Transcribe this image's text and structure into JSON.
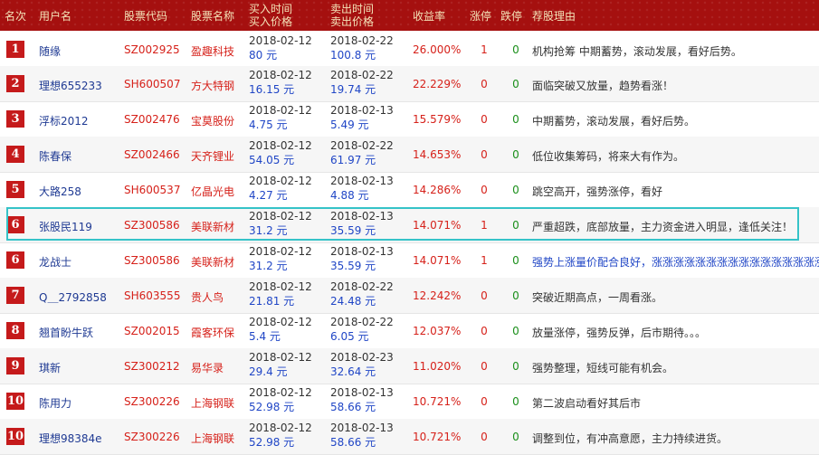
{
  "headers": {
    "rank": "名次",
    "user": "用户名",
    "code": "股票代码",
    "name": "股票名称",
    "buy_line1": "买入时间",
    "buy_line2": "买入价格",
    "sell_line1": "卖出时间",
    "sell_line2": "卖出价格",
    "rate": "收益率",
    "zt": "涨停",
    "dt": "跌停",
    "reason": "荐股理由"
  },
  "colors": {
    "header_bg": "#a5100f",
    "header_text": "#f4e3b8",
    "rank_bg": "#c51a1b",
    "stock_red": "#d6211a",
    "price_blue": "#2046c6",
    "highlight": "#35c3c8"
  },
  "rows": [
    {
      "rank": "1",
      "user": "随缘",
      "code": "SZ002925",
      "name": "盈趣科技",
      "buy_date": "2018-02-12",
      "buy_price": "80 元",
      "sell_date": "2018-02-22",
      "sell_price": "100.8 元",
      "rate": "26.000%",
      "zt": "1",
      "dt": "0",
      "reason": "机构抢筹 中期蓄势，滚动发展，看好后势。"
    },
    {
      "rank": "2",
      "user": "理想655233",
      "code": "SH600507",
      "name": "方大特钢",
      "buy_date": "2018-02-12",
      "buy_price": "16.15 元",
      "sell_date": "2018-02-22",
      "sell_price": "19.74 元",
      "rate": "22.229%",
      "zt": "0",
      "dt": "0",
      "reason": "面临突破又放量，趋势看涨！"
    },
    {
      "rank": "3",
      "user": "浮标2012",
      "code": "SZ002476",
      "name": "宝莫股份",
      "buy_date": "2018-02-12",
      "buy_price": "4.75 元",
      "sell_date": "2018-02-13",
      "sell_price": "5.49 元",
      "rate": "15.579%",
      "zt": "0",
      "dt": "0",
      "reason": "中期蓄势，滚动发展，看好后势。"
    },
    {
      "rank": "4",
      "user": "陈春保",
      "code": "SZ002466",
      "name": "天齐锂业",
      "buy_date": "2018-02-12",
      "buy_price": "54.05 元",
      "sell_date": "2018-02-22",
      "sell_price": "61.97 元",
      "rate": "14.653%",
      "zt": "0",
      "dt": "0",
      "reason": "低位收集筹码，将来大有作为。"
    },
    {
      "rank": "5",
      "user": "大路258",
      "code": "SH600537",
      "name": "亿晶光电",
      "buy_date": "2018-02-12",
      "buy_price": "4.27 元",
      "sell_date": "2018-02-13",
      "sell_price": "4.88 元",
      "rate": "14.286%",
      "zt": "0",
      "dt": "0",
      "reason": "跳空高开，强势涨停，看好"
    },
    {
      "rank": "6",
      "user": "张股民119",
      "code": "SZ300586",
      "name": "美联新材",
      "buy_date": "2018-02-12",
      "buy_price": "31.2 元",
      "sell_date": "2018-02-13",
      "sell_price": "35.59 元",
      "rate": "14.071%",
      "zt": "1",
      "dt": "0",
      "reason": "严重超跌，底部放量，主力资金进入明显，逢低关注！"
    },
    {
      "rank": "6",
      "user": "龙战士",
      "code": "SZ300586",
      "name": "美联新材",
      "buy_date": "2018-02-12",
      "buy_price": "31.2 元",
      "sell_date": "2018-02-13",
      "sell_price": "35.59 元",
      "rate": "14.071%",
      "zt": "1",
      "dt": "0",
      "reason": "强势上涨量价配合良好，涨涨涨涨涨涨涨涨涨涨涨涨涨涨涨涨涨涨涨涨涨涨"
    },
    {
      "rank": "7",
      "user": "Q＿2792858",
      "code": "SH603555",
      "name": "贵人鸟",
      "buy_date": "2018-02-12",
      "buy_price": "21.81 元",
      "sell_date": "2018-02-22",
      "sell_price": "24.48 元",
      "rate": "12.242%",
      "zt": "0",
      "dt": "0",
      "reason": "突破近期高点，一周看涨。"
    },
    {
      "rank": "8",
      "user": "翘首盼牛跃",
      "code": "SZ002015",
      "name": "霞客环保",
      "buy_date": "2018-02-12",
      "buy_price": "5.4 元",
      "sell_date": "2018-02-22",
      "sell_price": "6.05 元",
      "rate": "12.037%",
      "zt": "0",
      "dt": "0",
      "reason": "放量涨停，强势反弹，后市期待。。。"
    },
    {
      "rank": "9",
      "user": "琪新",
      "code": "SZ300212",
      "name": "易华录",
      "buy_date": "2018-02-12",
      "buy_price": "29.4 元",
      "sell_date": "2018-02-23",
      "sell_price": "32.64 元",
      "rate": "11.020%",
      "zt": "0",
      "dt": "0",
      "reason": "强势整理，短线可能有机会。"
    },
    {
      "rank": "10",
      "user": "陈用力",
      "code": "SZ300226",
      "name": "上海钢联",
      "buy_date": "2018-02-12",
      "buy_price": "52.98 元",
      "sell_date": "2018-02-13",
      "sell_price": "58.66 元",
      "rate": "10.721%",
      "zt": "0",
      "dt": "0",
      "reason": "第二波启动看好其后市"
    },
    {
      "rank": "10",
      "user": "理想98384e",
      "code": "SZ300226",
      "name": "上海钢联",
      "buy_date": "2018-02-12",
      "buy_price": "52.98 元",
      "sell_date": "2018-02-13",
      "sell_price": "58.66 元",
      "rate": "10.721%",
      "zt": "0",
      "dt": "0",
      "reason": "调整到位，有冲高意愿，主力持续进货。"
    }
  ]
}
